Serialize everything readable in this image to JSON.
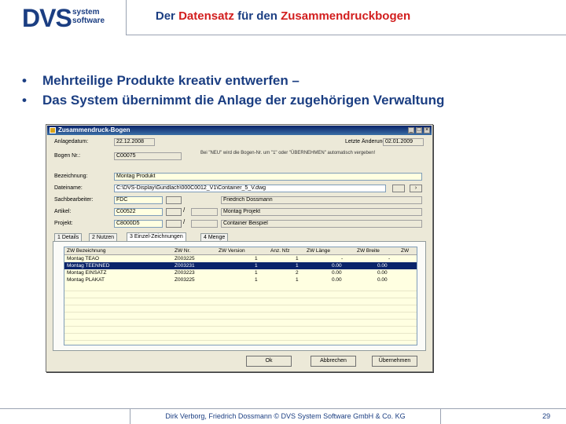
{
  "logo": {
    "main": "DVS",
    "sub_line1": "system",
    "sub_line2": "software"
  },
  "slide": {
    "title_part1": "Der ",
    "title_part2": "Datensatz",
    "title_part3": " für den ",
    "title_part4": "Zusammendruckbogen",
    "bullets": [
      "Mehrteilige Produkte kreativ entwerfen –",
      "Das System übernimmt die Anlage der zugehörigen Verwaltung"
    ],
    "bullet_char": "•",
    "footer": "Dirk Verborg, Friedrich Dossmann © DVS System Software GmbH & Co. KG",
    "page_number": "29"
  },
  "dialog": {
    "title": "Zusammendruck-Bogen",
    "anlagedatum_label": "Anlagedatum:",
    "anlagedatum_value": "22.12.2008",
    "letzte_aenderung_label": "Letzte Änderung:",
    "letzte_aenderung_value": "02.01.2009",
    "bogen_label": "Bogen Nr.:",
    "bogen_value": "C00075",
    "bogen_note": "Bei \"NEU\" wird die Bogen-Nr. um \"1\" oder \"ÜBERNEHMEN\" automatisch vergeben!",
    "bezeichnung_label": "Bezeichnung:",
    "bezeichnung_value": "Montag Produkt",
    "dateiname_label": "Dateiname:",
    "dateiname_value": "C:\\DVS-Display\\Gundlach\\000C0012_V1\\Container_5_V.dwg",
    "sachbearbeiter_label": "Sachbearbeiter:",
    "sachbearbeiter_code": "FDC",
    "sachbearbeiter_name": "Friedrich Dossmann",
    "artikel_label": "Artikel:",
    "artikel_code": "C00522",
    "artikel_name": "Montag Projekt",
    "projekt_label": "Projekt:",
    "projekt_code": "C8000D5",
    "projekt_name": "Container Beispiel",
    "slash": "/",
    "tabs": [
      "1 Details",
      "2 Nutzen",
      "3 Einzel-Zeichnungen",
      "4 Menge"
    ],
    "grid": {
      "headers": [
        "ZW Bezeichnung",
        "ZW Nr.",
        "ZW Version",
        "Anz. Nfz",
        "ZW Länge",
        "ZW Breite",
        "ZW"
      ],
      "rows": [
        [
          "Montag TEAO",
          "Z003225",
          "1",
          "1",
          "-",
          "-"
        ],
        [
          "Montag TEENNED",
          "Z003231",
          "1",
          "1",
          "0.00",
          "0.00"
        ],
        [
          "Montag EINSATZ",
          "Z003223",
          "1",
          "2",
          "0.00",
          "0.00"
        ],
        [
          "Montag PLAKAT",
          "Z003225",
          "1",
          "1",
          "0.00",
          "0.00"
        ]
      ]
    },
    "buttons": {
      "ok": "Ok",
      "abbrechen": "Abbrechen",
      "uebernehmen": "Übernehmen"
    }
  },
  "colors": {
    "brand": "#1b3e82",
    "accent": "#d21e1e",
    "selection": "#0a246a"
  }
}
